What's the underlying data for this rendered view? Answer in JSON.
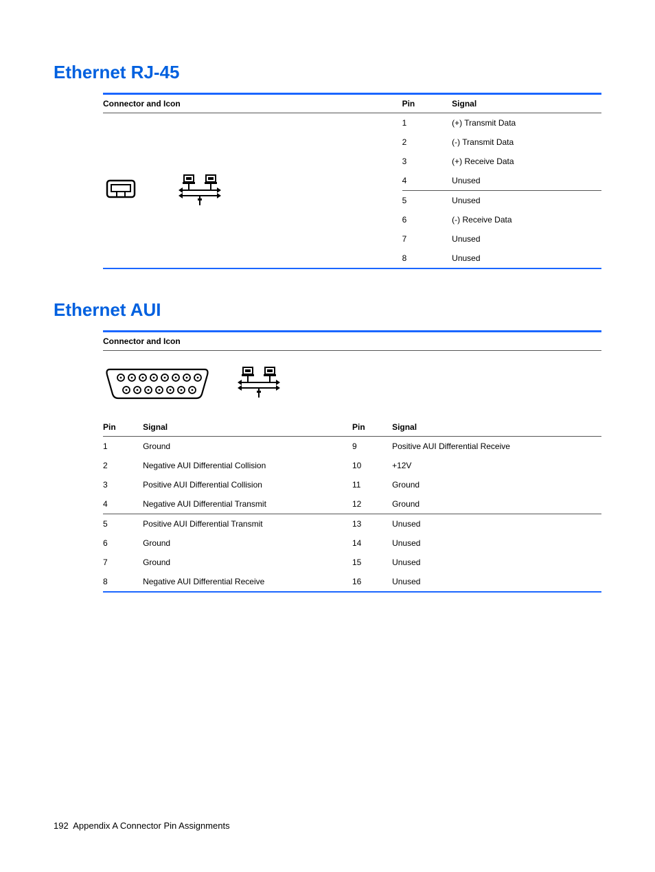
{
  "sections": {
    "rj45": {
      "title": "Ethernet RJ-45",
      "header": {
        "conn": "Connector and Icon",
        "pin": "Pin",
        "signal": "Signal"
      },
      "pins": [
        {
          "n": "1",
          "s": "(+) Transmit Data"
        },
        {
          "n": "2",
          "s": "(-) Transmit Data"
        },
        {
          "n": "3",
          "s": "(+) Receive Data"
        },
        {
          "n": "4",
          "s": "Unused"
        },
        {
          "n": "5",
          "s": "Unused"
        },
        {
          "n": "6",
          "s": "(-) Receive Data"
        },
        {
          "n": "7",
          "s": "Unused"
        },
        {
          "n": "8",
          "s": "Unused"
        }
      ]
    },
    "aui": {
      "title": "Ethernet AUI",
      "header": {
        "conn": "Connector and Icon",
        "pin": "Pin",
        "signal": "Signal"
      },
      "left": [
        {
          "n": "1",
          "s": "Ground"
        },
        {
          "n": "2",
          "s": "Negative AUI Differential Collision"
        },
        {
          "n": "3",
          "s": "Positive AUI Differential Collision"
        },
        {
          "n": "4",
          "s": "Negative AUI Differential Transmit"
        },
        {
          "n": "5",
          "s": "Positive AUI Differential Transmit"
        },
        {
          "n": "6",
          "s": "Ground"
        },
        {
          "n": "7",
          "s": "Ground"
        },
        {
          "n": "8",
          "s": "Negative AUI Differential Receive"
        }
      ],
      "right": [
        {
          "n": "9",
          "s": "Positive AUI Differential Receive"
        },
        {
          "n": "10",
          "s": "+12V"
        },
        {
          "n": "11",
          "s": "Ground"
        },
        {
          "n": "12",
          "s": "Ground"
        },
        {
          "n": "13",
          "s": "Unused"
        },
        {
          "n": "14",
          "s": "Unused"
        },
        {
          "n": "15",
          "s": "Unused"
        },
        {
          "n": "16",
          "s": "Unused"
        }
      ]
    }
  },
  "footer": {
    "page": "192",
    "text": "Appendix A   Connector Pin Assignments"
  }
}
